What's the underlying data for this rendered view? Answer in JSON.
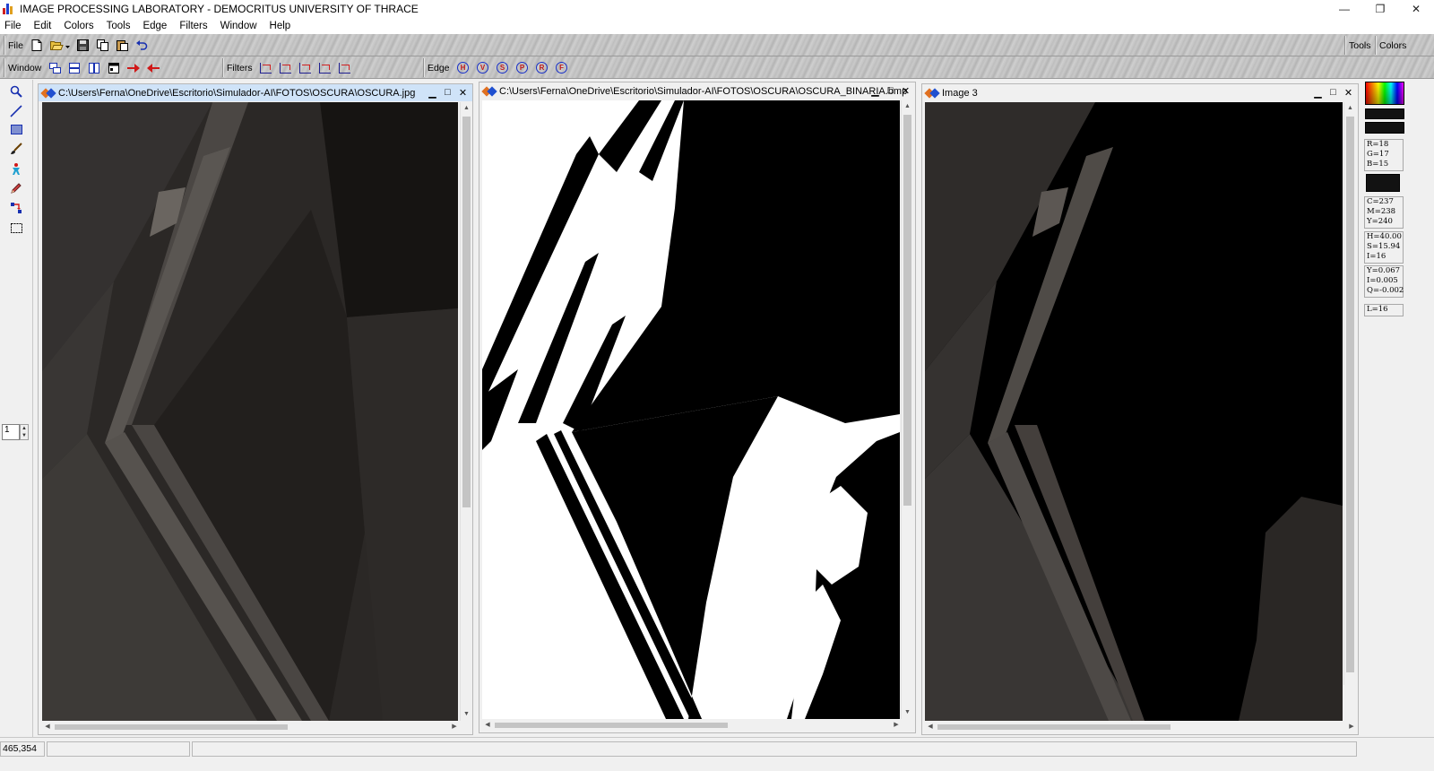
{
  "window": {
    "title": "IMAGE PROCESSING LABORATORY - DEMOCRITUS UNIVERSITY OF THRACE",
    "controls": [
      "—",
      "❐",
      "✕"
    ]
  },
  "menu": [
    "File",
    "Edit",
    "Colors",
    "Tools",
    "Edge",
    "Filters",
    "Window",
    "Help"
  ],
  "toolbar": {
    "file_label": "File",
    "window_label": "Window",
    "filters_label": "Filters",
    "edge_label": "Edge",
    "tools_label": "Tools",
    "colors_label": "Colors",
    "edge_buttons": [
      "H",
      "V",
      "S",
      "P",
      "R",
      "F"
    ]
  },
  "toolbox": {
    "spin_value": "1"
  },
  "images": [
    {
      "title": "C:\\Users\\Ferna\\OneDrive\\Escritorio\\Simulador-AI\\FOTOS\\OSCURA\\OSCURA.jpg",
      "active": true
    },
    {
      "title": "C:\\Users\\Ferna\\OneDrive\\Escritorio\\Simulador-AI\\FOTOS\\OSCURA\\OSCURA_BINARIA.bmp",
      "active": false
    },
    {
      "title": "Image 3",
      "active": false
    }
  ],
  "child_controls": {
    "minimize": "▁",
    "maximize": "□",
    "close": "✕"
  },
  "color_info": {
    "rgb": [
      "R=18",
      "G=17",
      "B=15"
    ],
    "cmy": [
      "C=237",
      "M=238",
      "Y=240"
    ],
    "hsi": [
      "H=40.00",
      "S=15.94",
      "I=16"
    ],
    "yiq": [
      "Y=0.067",
      "I=0.005",
      "Q=-0.002"
    ],
    "lum": [
      "L=16"
    ],
    "current_color": "#121212"
  },
  "status": {
    "coords": "465,354"
  }
}
